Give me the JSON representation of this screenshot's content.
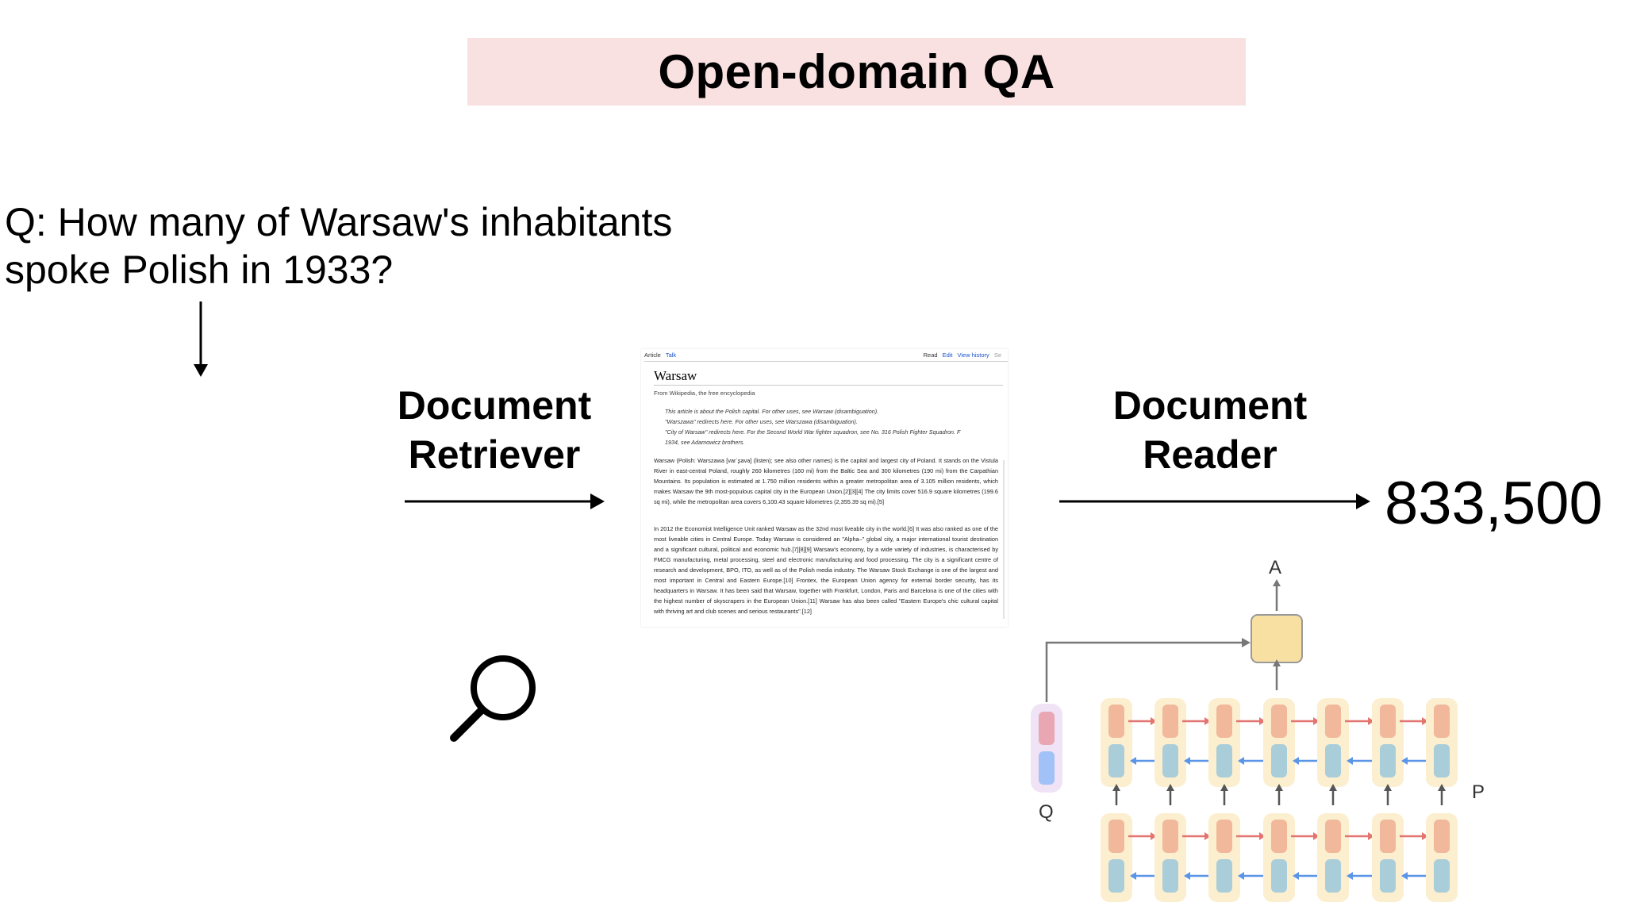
{
  "title": "Open-domain QA",
  "question": {
    "line1": "Q:  How many of Warsaw's inhabitants",
    "line2": "spoke Polish in 1933?"
  },
  "retriever_label": {
    "line1": "Document",
    "line2": "Retriever"
  },
  "reader_label": {
    "line1": "Document",
    "line2": "Reader"
  },
  "answer": "833,500",
  "model": {
    "output_label": "A",
    "question_label": "Q",
    "passage_label": "P"
  },
  "colors": {
    "title_bg": "#f8e1e0",
    "cell_bg": "#fbefd0",
    "forward_state": "#f2b89b",
    "backward_state": "#a9cdd9",
    "question_bg": "#efe3f5",
    "question_top": "#e8a7b2",
    "question_bottom": "#a2c2f7",
    "output_box": "#f8dfa2",
    "forward_arrow": "#e27570",
    "backward_arrow": "#5b95e8"
  },
  "icons": {
    "search": "magnifier-icon"
  },
  "wiki": {
    "tabs_left": [
      "Article",
      "Talk"
    ],
    "tabs_right": [
      "Read",
      "Edit",
      "View history",
      "Se"
    ],
    "title": "Warsaw",
    "from": "From Wikipedia, the free encyclopedia",
    "hatnotes": [
      "This article is about the Polish capital. For other uses, see Warsaw (disambiguation).",
      "\"Warszawa\" redirects here. For other uses, see Warszawa (disambiguation).",
      "\"City of Warsaw\" redirects here. For the Second World War fighter squadron, see No. 316 Polish Fighter Squadron. F",
      "1934, see Adamowicz brothers."
    ],
    "para1": "Warsaw (Polish: Warszawa [varˈʂava] (listen); see also other names) is the capital and largest city of Poland. It stands on the Vistula River in east-central Poland, roughly 260 kilometres (160 mi) from the Baltic Sea and 300 kilometres (190 mi) from the Carpathian Mountains. Its population is estimated at 1.750 million residents within a greater metropolitan area of 3.105 million residents, which makes Warsaw the 9th most-populous capital city in the European Union.[2][3][4] The city limits cover 516.9 square kilometres (199.6 sq mi), while the metropolitan area covers 6,100.43 square kilometres (2,355.39 sq mi).[5]",
    "para2": "In 2012 the Economist Intelligence Unit ranked Warsaw as the 32nd most liveable city in the world.[6] It was also ranked as one of the most liveable cities in Central Europe. Today Warsaw is considered an \"Alpha–\" global city, a major international tourist destination and a significant cultural, political and economic hub.[7][8][9] Warsaw's economy, by a wide variety of industries, is characterised by FMCG manufacturing, metal processing, steel and electronic manufacturing and food processing. The city is a significant centre of research and development, BPO, ITO, as well as of the Polish media industry. The Warsaw Stock Exchange is one of the largest and most important in Central and Eastern Europe.[10] Frontex, the European Union agency for external border security, has its headquarters in Warsaw. It has been said that Warsaw, together with Frankfurt, London, Paris and Barcelona is one of the cities with the highest number of skyscrapers in the European Union.[11] Warsaw has also been called \"Eastern Europe's chic cultural capital with thriving art and club scenes and serious restaurants\".[12]"
  }
}
